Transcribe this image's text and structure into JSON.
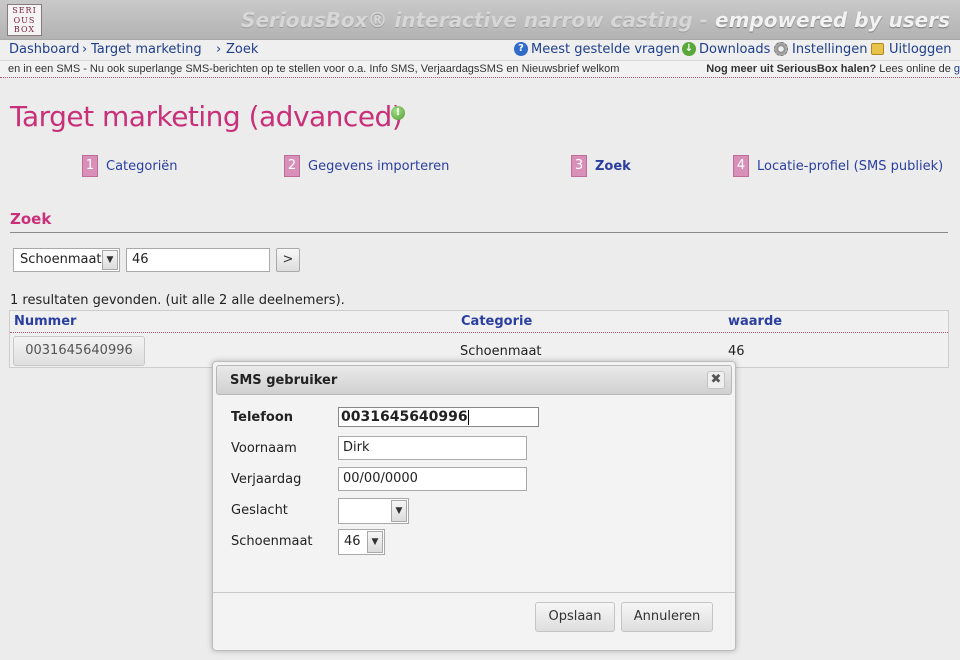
{
  "header": {
    "logo_lines": [
      "SERI",
      "OUS",
      "BOX"
    ],
    "tagline_main": "SeriousBox® interactive narrow casting - ",
    "tagline_strong": "empowered by users"
  },
  "breadcrumb": {
    "items": [
      "Dashboard",
      "Target marketing",
      "Zoek"
    ],
    "separator": "›"
  },
  "toplinks": {
    "faq": "Meest gestelde vragen",
    "downloads": "Downloads",
    "settings": "Instellingen",
    "logout": "Uitloggen"
  },
  "ticker": {
    "text": "en in een SMS - Nu ook superlange SMS-berichten op te stellen voor o.a. Info SMS, VerjaardagsSMS en Nieuwsbrief welkom",
    "right_bold": "Nog meer uit SeriousBox halen?",
    "right_text": " Lees online de ",
    "right_link": "g"
  },
  "page": {
    "title": "Target marketing (advanced)",
    "info_icon": "!"
  },
  "steps": [
    {
      "num": "1",
      "label": "Categoriën"
    },
    {
      "num": "2",
      "label": "Gegevens importeren"
    },
    {
      "num": "3",
      "label": "Zoek"
    },
    {
      "num": "4",
      "label": "Locatie-profiel (SMS publiek)"
    }
  ],
  "section": {
    "title": "Zoek"
  },
  "search": {
    "field_select": "Schoenmaat",
    "value": "46",
    "go_label": ">"
  },
  "results": {
    "summary": "1 resultaten gevonden. (uit alle 2 alle deelnemers).",
    "columns": [
      "Nummer",
      "Categorie",
      "waarde"
    ],
    "rows": [
      {
        "nummer": "0031645640996",
        "categorie": "Schoenmaat",
        "waarde": "46"
      }
    ]
  },
  "dialog": {
    "title": "SMS gebruiker",
    "close": "✖",
    "fields": {
      "telefoon_label": "Telefoon",
      "telefoon_value": "0031645640996",
      "voornaam_label": "Voornaam",
      "voornaam_value": "Dirk",
      "verjaardag_label": "Verjaardag",
      "verjaardag_value": "00/00/0000",
      "geslacht_label": "Geslacht",
      "geslacht_value": "",
      "schoenmaat_label": "Schoenmaat",
      "schoenmaat_value": "46"
    },
    "save_label": "Opslaan",
    "cancel_label": "Annuleren"
  },
  "colors": {
    "accent": "#c8307a",
    "link": "#1f3f8a",
    "step_badge": "#d890b8"
  }
}
